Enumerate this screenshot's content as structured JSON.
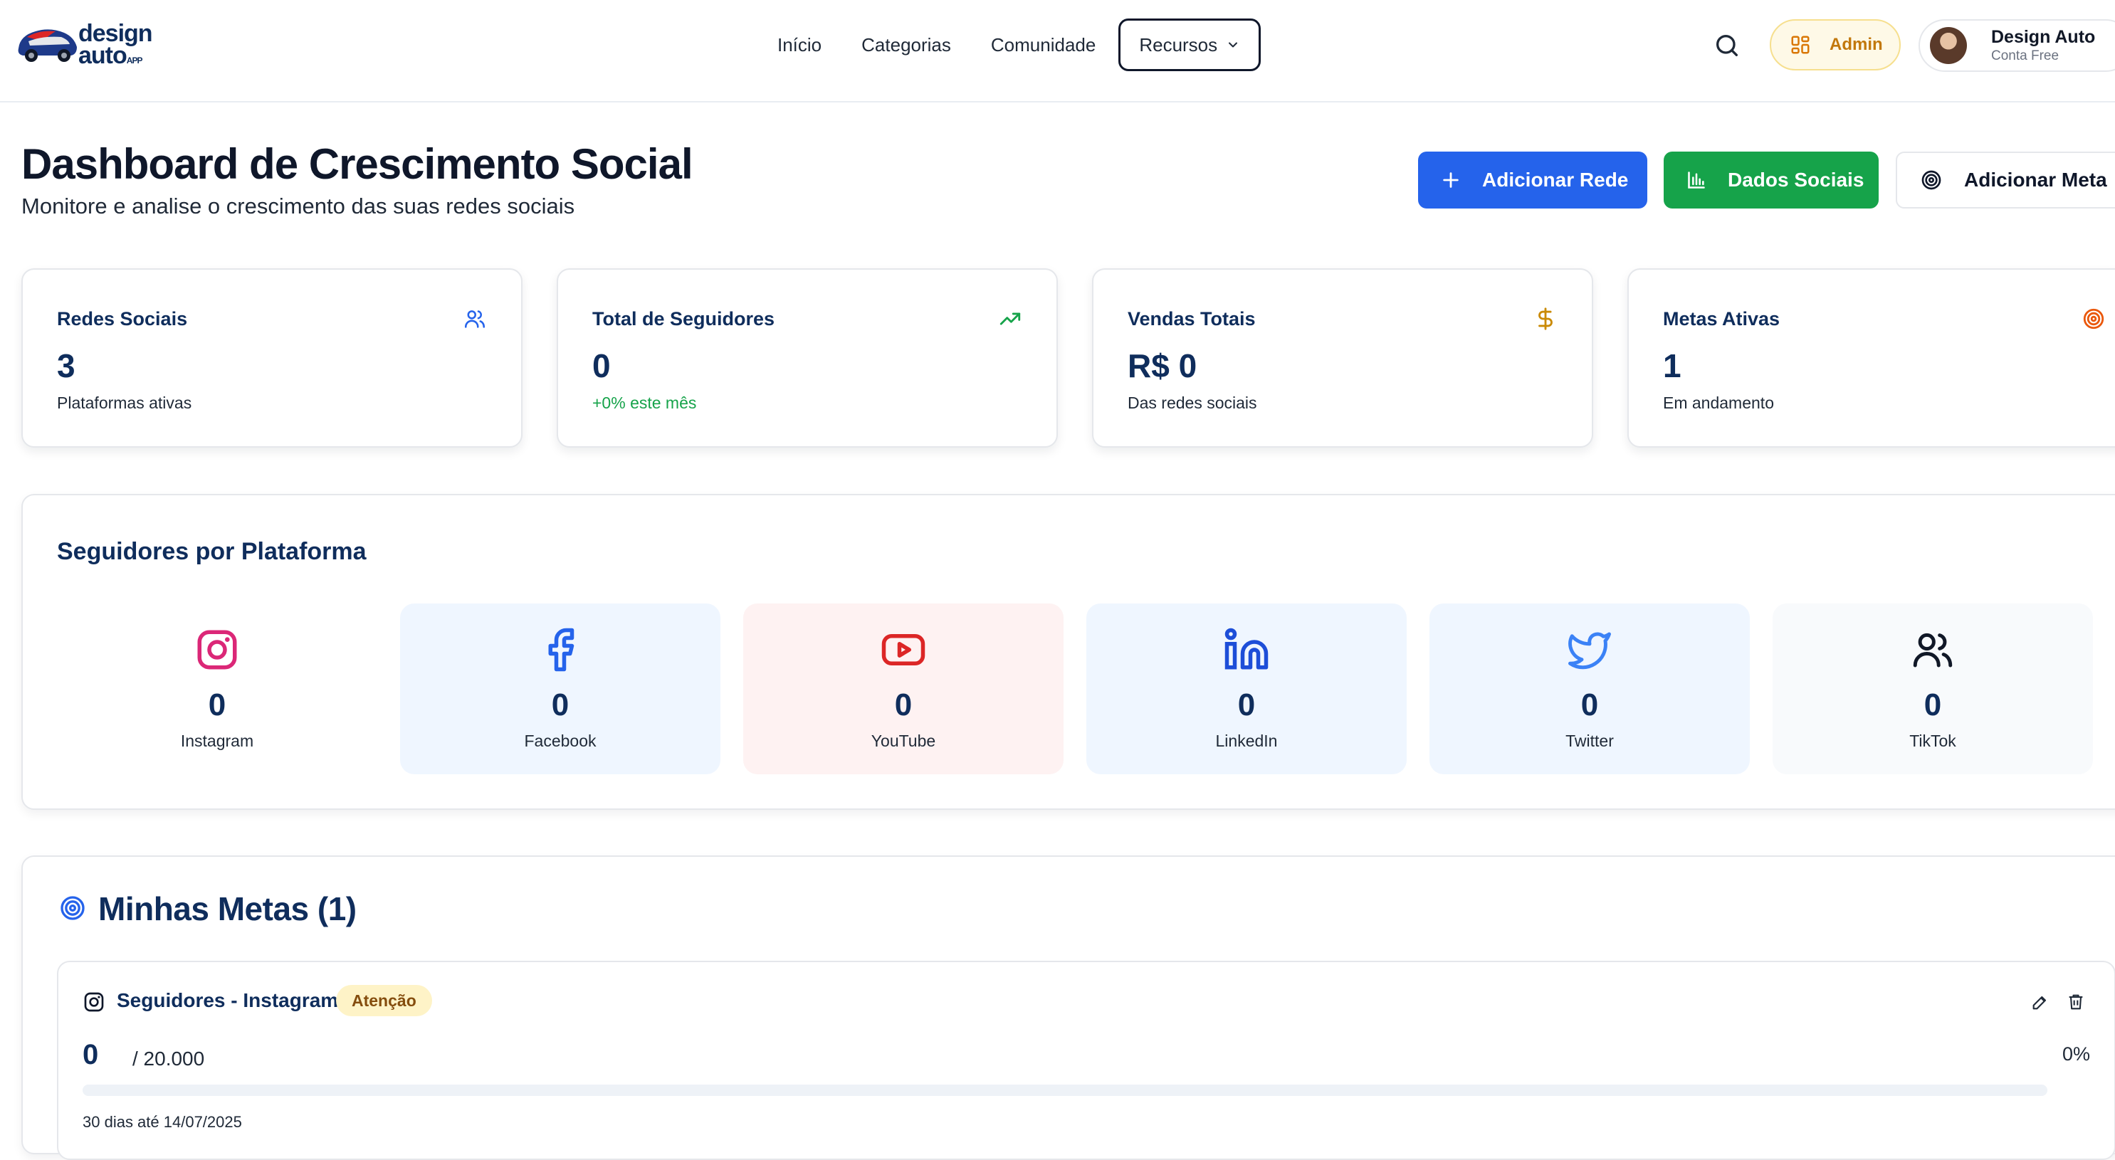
{
  "brand": {
    "line1": "design",
    "line2": "auto",
    "suffix": "APP"
  },
  "nav": {
    "items": [
      "Início",
      "Categorias",
      "Comunidade"
    ],
    "active": "Recursos"
  },
  "header": {
    "admin_label": "Admin",
    "user_name": "Design Auto",
    "user_plan": "Conta Free"
  },
  "page": {
    "title": "Dashboard de Crescimento Social",
    "subtitle": "Monitore e analise o crescimento das suas redes sociais",
    "buttons": {
      "add_network": "Adicionar Rede",
      "social_data": "Dados Sociais",
      "add_goal": "Adicionar Meta"
    }
  },
  "stats": [
    {
      "label": "Redes Sociais",
      "value": "3",
      "sub": "Plataformas ativas",
      "icon": "users-icon",
      "color": "#2563eb"
    },
    {
      "label": "Total de Seguidores",
      "value": "0",
      "sub": "+0% este mês",
      "icon": "trending-up-icon",
      "color": "#16a34a"
    },
    {
      "label": "Vendas Totais",
      "value": "R$ 0",
      "sub": "Das redes sociais",
      "icon": "dollar-icon",
      "color": "#ca8a04"
    },
    {
      "label": "Metas Ativas",
      "value": "1",
      "sub": "Em andamento",
      "icon": "target-icon",
      "color": "#ea580c"
    }
  ],
  "platforms": {
    "title": "Seguidores por Plataforma",
    "items": [
      {
        "name": "Instagram",
        "value": "0",
        "icon": "instagram-icon",
        "color": "#db2777",
        "bg": "#ffffff"
      },
      {
        "name": "Facebook",
        "value": "0",
        "icon": "facebook-icon",
        "color": "#2563eb",
        "bg": "#eff6ff"
      },
      {
        "name": "YouTube",
        "value": "0",
        "icon": "youtube-icon",
        "color": "#dc2626",
        "bg": "#fef2f2"
      },
      {
        "name": "LinkedIn",
        "value": "0",
        "icon": "linkedin-icon",
        "color": "#1d4ed8",
        "bg": "#eff6ff"
      },
      {
        "name": "Twitter",
        "value": "0",
        "icon": "twitter-icon",
        "color": "#3b82f6",
        "bg": "#eff6ff"
      },
      {
        "name": "TikTok",
        "value": "0",
        "icon": "tiktok-users-icon",
        "color": "#111827",
        "bg": "#f8fafc"
      }
    ]
  },
  "goals": {
    "title": "Minhas Metas (1)",
    "items": [
      {
        "name": "Seguidores - Instagram",
        "badge": "Atenção",
        "current": "0",
        "target": "/ 20.000",
        "percent_label": "0%",
        "progress": 0,
        "dates": "30 dias até 14/07/2025"
      }
    ]
  }
}
